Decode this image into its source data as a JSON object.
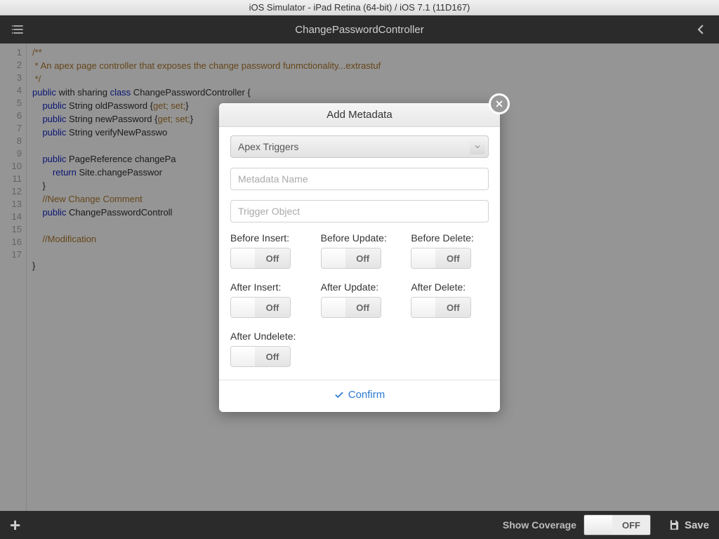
{
  "mac_title": "iOS Simulator - iPad Retina (64-bit) / iOS 7.1 (11D167)",
  "topbar": {
    "title": "ChangePasswordController"
  },
  "code": {
    "lines": [
      "1",
      "2",
      "3",
      "4",
      "5",
      "6",
      "7",
      "8",
      "9",
      "10",
      "11",
      "12",
      "13",
      "14",
      "15",
      "16",
      "17"
    ],
    "l1": "/**",
    "l2": " * An apex page controller that exposes the change password funmctionality...extrastuf",
    "l3": " */",
    "l4a": "public",
    "l4b": " with sharing ",
    "l4c": "class",
    "l4d": " ChangePasswordController {",
    "l5a": "    public",
    "l5b": " String oldPassword {",
    "l5c": "get; set;",
    "l5d": "}",
    "l6a": "    public",
    "l6b": " String newPassword {",
    "l6c": "get; set;",
    "l6d": "}",
    "l7a": "    public",
    "l7b": " String verifyNewPasswo",
    "l8": "",
    "l9a": "    public",
    "l9b": " PageReference changePa",
    "l10a": "        return",
    "l10b": " Site.changePasswor",
    "l11": "    }",
    "l12": "    //New Change Comment",
    "l13a": "    public",
    "l13b": " ChangePasswordControll",
    "l14": "",
    "l15": "    //Modification",
    "l16": "",
    "l17": "}"
  },
  "modal": {
    "title": "Add Metadata",
    "select_value": "Apex Triggers",
    "name_placeholder": "Metadata Name",
    "object_placeholder": "Trigger Object",
    "toggles": [
      {
        "label": "Before Insert:",
        "state": "Off"
      },
      {
        "label": "Before Update:",
        "state": "Off"
      },
      {
        "label": "Before Delete:",
        "state": "Off"
      },
      {
        "label": "After Insert:",
        "state": "Off"
      },
      {
        "label": "After Update:",
        "state": "Off"
      },
      {
        "label": "After Delete:",
        "state": "Off"
      },
      {
        "label": "After Undelete:",
        "state": "Off"
      }
    ],
    "confirm": "Confirm"
  },
  "bottombar": {
    "show_coverage": "Show Coverage",
    "coverage_state": "OFF",
    "save": "Save"
  }
}
